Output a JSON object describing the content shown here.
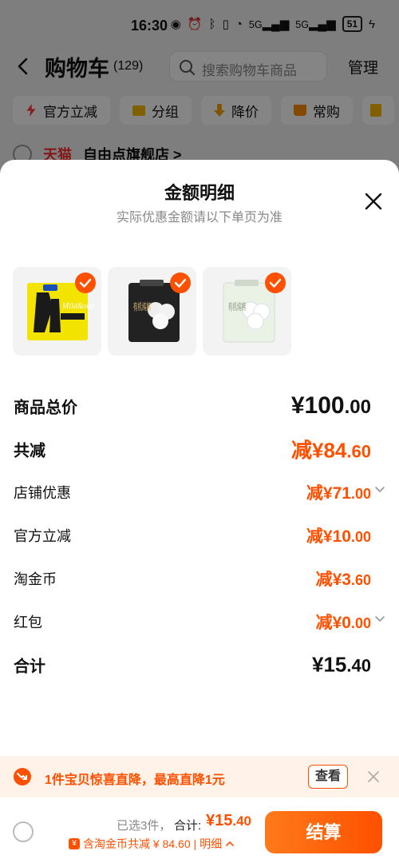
{
  "status": {
    "time": "16:30",
    "signal1": "5G",
    "signal2": "5G",
    "battery": "51"
  },
  "nav": {
    "title": "购物车",
    "count": "(129)",
    "search_placeholder": "搜索购物车商品",
    "manage": "管理"
  },
  "chips": [
    {
      "label": "官方立减",
      "color": "#ff3a3a"
    },
    {
      "label": "分组",
      "color": "#f5b800"
    },
    {
      "label": "降价",
      "color": "#f5a000"
    },
    {
      "label": "常购",
      "color": "#ff8a00"
    }
  ],
  "store": {
    "tag": "天猫",
    "name": "自由点旗舰店 >"
  },
  "sheet": {
    "title": "金额明细",
    "subtitle": "实际优惠金额请以下单页为准",
    "products": [
      {
        "name": "Mild&soft",
        "color": "#f3e300"
      },
      {
        "name": "有机纯棉",
        "color": "#222222"
      },
      {
        "name": "有机纯棉",
        "color": "#eaf2e6"
      }
    ],
    "rows": {
      "subtotal": {
        "label": "商品总价",
        "int": "¥100",
        "dec": ".00"
      },
      "total_discount": {
        "label": "共减",
        "int": "减¥84",
        "dec": ".60"
      },
      "shop_discount": {
        "label": "店铺优惠",
        "int": "减¥71",
        "dec": ".00"
      },
      "official_discount": {
        "label": "官方立减",
        "int": "减¥10",
        "dec": ".00"
      },
      "coins": {
        "label": "淘金币",
        "int": "减¥3",
        "dec": ".60"
      },
      "red_packet": {
        "label": "红包",
        "int": "减¥0",
        "dec": ".00"
      },
      "total": {
        "label": "合计",
        "int": "¥15",
        "dec": ".40"
      }
    }
  },
  "promo": {
    "text": "1件宝贝惊喜直降，最高直降1元",
    "button": "查看"
  },
  "footer": {
    "selected": "已选3件，",
    "total_label": "合计:",
    "total_int": "¥15",
    "total_dec": ".40",
    "coin_symbol": "¥",
    "coin_text": "含淘金币共减 ¥ 84.60 |",
    "detail": "明细",
    "checkout": "结算"
  },
  "colors": {
    "accent": "#ff5000",
    "promo_bg": "#fff2e8"
  }
}
